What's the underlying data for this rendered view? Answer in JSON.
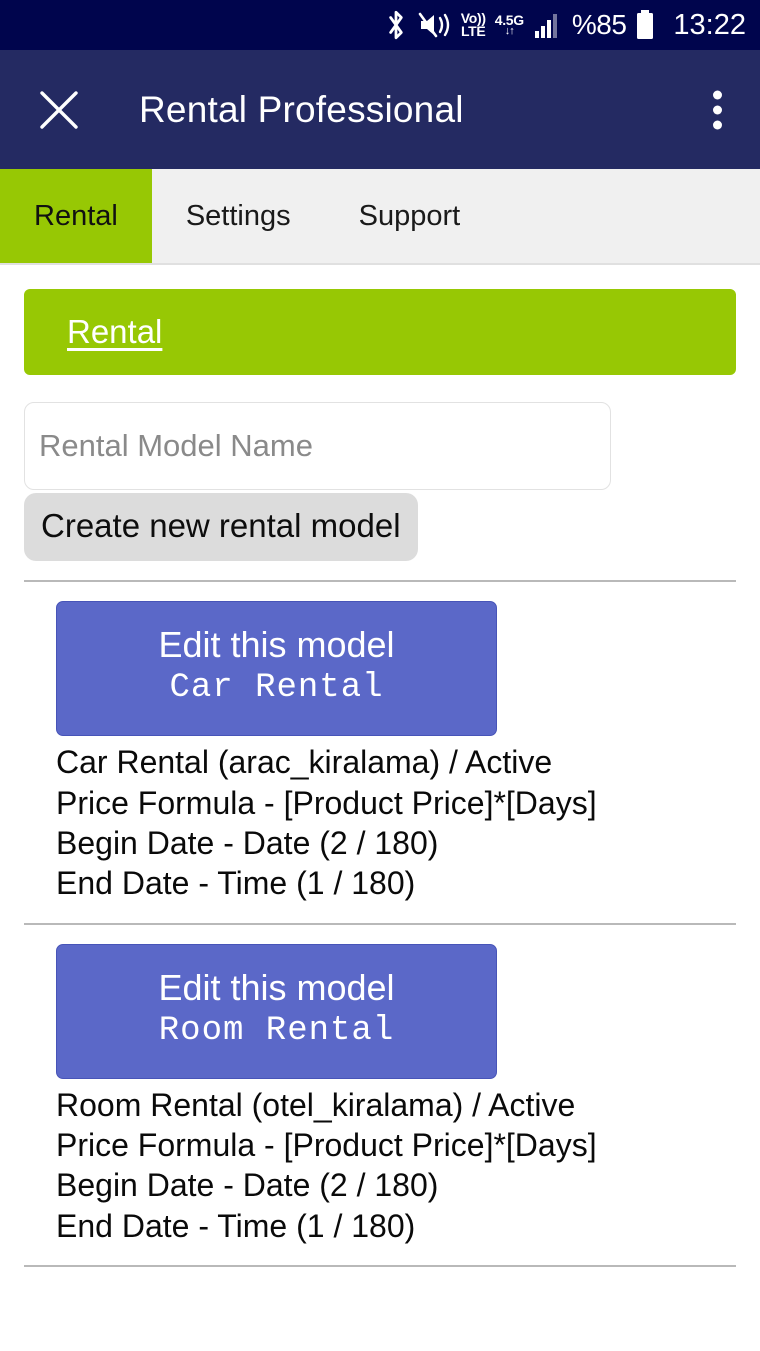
{
  "status_bar": {
    "icons": [
      "bluetooth-icon",
      "mute-vibrate-icon",
      "volte-icon",
      "network-4-5g-icon",
      "signal-bars-icon"
    ],
    "volte_top": "Vo))",
    "volte_bottom": "LTE",
    "network_top": "4.5G",
    "network_bottom": "↓↑",
    "battery_percent": "%85",
    "clock": "13:22"
  },
  "header": {
    "close_label": "✕",
    "title": "Rental Professional",
    "menu_label": "⋮"
  },
  "tabs": [
    {
      "label": "Rental",
      "active": true
    },
    {
      "label": "Settings",
      "active": false
    },
    {
      "label": "Support",
      "active": false
    }
  ],
  "banner": {
    "link_label": "Rental"
  },
  "form": {
    "input_value": "",
    "input_placeholder": "Rental Model Name",
    "create_button_label": "Create new rental model"
  },
  "models": [
    {
      "edit_label": "Edit this model",
      "name": "Car Rental",
      "info": [
        "Car Rental (arac_kiralama) / Active",
        "Price Formula - [Product Price]*[Days]",
        "Begin Date - Date (2 / 180)",
        "End Date - Time (1 / 180)"
      ]
    },
    {
      "edit_label": "Edit this model",
      "name": "Room Rental",
      "info": [
        "Room Rental (otel_kiralama) / Active",
        "Price Formula - [Product Price]*[Days]",
        "Begin Date - Date (2 / 180)",
        "End Date - Time (1 / 180)"
      ]
    }
  ],
  "colors": {
    "status_bar_bg": "#00054d",
    "header_bg": "#242a62",
    "accent_green": "#97c804",
    "button_blue": "#5b68c8",
    "tab_bg": "#f0f0f0",
    "create_btn_bg": "#dcdcdc"
  }
}
